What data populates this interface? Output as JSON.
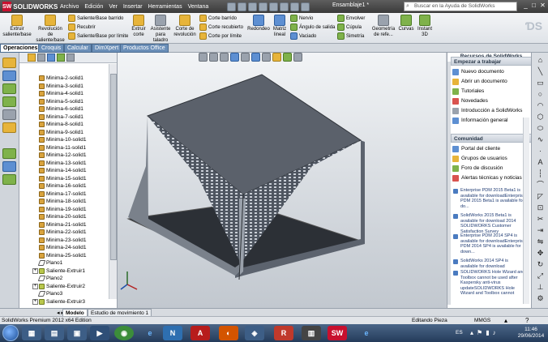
{
  "app": {
    "logo_text": "SOLIDWORKS",
    "logo_mark": "SW",
    "menu": [
      "Archivo",
      "Edición",
      "Ver",
      "Insertar",
      "Herramientas",
      "Ventana"
    ],
    "document_title": "Ensamblaje1 *",
    "search_placeholder": "Buscar en la Ayuda de SolidWorks",
    "window_controls": [
      "_",
      "□",
      "✕"
    ]
  },
  "ribbon": {
    "big": [
      {
        "label1": "Extruir",
        "label2": "saliente/base",
        "icon": "extrude-boss-icon",
        "color": "y"
      },
      {
        "label1": "Revolución",
        "label2": "de saliente/base",
        "icon": "revolve-boss-icon",
        "color": "y"
      },
      {
        "label1": "Extruir",
        "label2": "corte",
        "icon": "extrude-cut-icon",
        "color": "y"
      },
      {
        "label1": "Asistente",
        "label2": "para taladro",
        "icon": "hole-wizard-icon",
        "color": "gr"
      },
      {
        "label1": "Corte de",
        "label2": "revolución",
        "icon": "revolve-cut-icon",
        "color": "y"
      },
      {
        "label1": "Redondeo",
        "label2": "",
        "icon": "fillet-icon",
        "color": "b"
      },
      {
        "label1": "Matriz",
        "label2": "lineal",
        "icon": "linear-pattern-icon",
        "color": "b"
      },
      {
        "label1": "Geometría",
        "label2": "de refe...",
        "icon": "reference-geometry-icon",
        "color": "gr"
      },
      {
        "label1": "Curvas",
        "label2": "",
        "icon": "curves-icon",
        "color": "g"
      },
      {
        "label1": "Instant",
        "label2": "3D",
        "icon": "instant3d-icon",
        "color": "g"
      }
    ],
    "small": [
      {
        "label": "Saliente/Base barrido",
        "icon": "swept-boss-icon",
        "color": "y"
      },
      {
        "label": "Recubrir",
        "icon": "loft-icon",
        "color": "y"
      },
      {
        "label": "Saliente/Base por límite",
        "icon": "boundary-boss-icon",
        "color": "y"
      },
      {
        "label": "Corte barrido",
        "icon": "swept-cut-icon",
        "color": "y"
      },
      {
        "label": "Corte recubierto",
        "icon": "lofted-cut-icon",
        "color": "y"
      },
      {
        "label": "Corte por límite",
        "icon": "boundary-cut-icon",
        "color": "y"
      },
      {
        "label": "Nervio",
        "icon": "rib-icon",
        "color": "g"
      },
      {
        "label": "Ángulo de salida",
        "icon": "draft-icon",
        "color": "g"
      },
      {
        "label": "Vaciado",
        "icon": "shell-icon",
        "color": "b"
      },
      {
        "label": "Envolver",
        "icon": "wrap-icon",
        "color": "g"
      },
      {
        "label": "Cúpula",
        "icon": "dome-icon",
        "color": "g"
      },
      {
        "label": "Simetría",
        "icon": "mirror-icon",
        "color": "g"
      }
    ]
  },
  "tabs": [
    "Operaciones",
    "Croquis",
    "Calcular",
    "DimXpert",
    "Productos Office"
  ],
  "tree": {
    "items": [
      {
        "label": "Minima-2-solid1",
        "type": "part"
      },
      {
        "label": "Minima-3-solid1",
        "type": "part"
      },
      {
        "label": "Minima-4-solid1",
        "type": "part"
      },
      {
        "label": "Minima-5-solid1",
        "type": "part"
      },
      {
        "label": "Minima-6-solid1",
        "type": "part"
      },
      {
        "label": "Minima-7-solid1",
        "type": "part"
      },
      {
        "label": "Minima-8-solid1",
        "type": "part"
      },
      {
        "label": "Minima-9-solid1",
        "type": "part"
      },
      {
        "label": "Minima-10-solid1",
        "type": "part"
      },
      {
        "label": "Minima-11-solid1",
        "type": "part"
      },
      {
        "label": "Minima-12-solid1",
        "type": "part"
      },
      {
        "label": "Minima-13-solid1",
        "type": "part"
      },
      {
        "label": "Minima-14-solid1",
        "type": "part"
      },
      {
        "label": "Minima-15-solid1",
        "type": "part"
      },
      {
        "label": "Minima-16-solid1",
        "type": "part"
      },
      {
        "label": "Minima-17-solid1",
        "type": "part"
      },
      {
        "label": "Minima-18-solid1",
        "type": "part"
      },
      {
        "label": "Minima-19-solid1",
        "type": "part"
      },
      {
        "label": "Minima-20-solid1",
        "type": "part"
      },
      {
        "label": "Minima-21-solid1",
        "type": "part"
      },
      {
        "label": "Minima-22-solid1",
        "type": "part"
      },
      {
        "label": "Minima-23-solid1",
        "type": "part"
      },
      {
        "label": "Minima-24-solid1",
        "type": "part"
      },
      {
        "label": "Minima-25-solid1",
        "type": "part"
      },
      {
        "label": "Plano1",
        "type": "plane"
      },
      {
        "label": "Saliente-Extruir1",
        "type": "feat"
      },
      {
        "label": "Plano2",
        "type": "plane"
      },
      {
        "label": "Saliente-Extruir2",
        "type": "feat"
      },
      {
        "label": "Plano3",
        "type": "plane"
      },
      {
        "label": "Saliente-Extruir3",
        "type": "feat"
      }
    ]
  },
  "taskpane": {
    "title": "Recursos de SolidWorks",
    "sections": [
      {
        "header": "Empezar a trabajar",
        "items": [
          {
            "label": "Nuevo documento",
            "icon": "new-document-icon"
          },
          {
            "label": "Abrir un documento",
            "icon": "open-document-icon"
          },
          {
            "label": "Tutoriales",
            "icon": "tutorials-icon"
          },
          {
            "label": "Novedades",
            "icon": "whats-new-icon"
          },
          {
            "label": "Introducción a SolidWorks",
            "icon": "intro-icon"
          },
          {
            "label": "Información general",
            "icon": "info-icon"
          }
        ]
      },
      {
        "header": "Comunidad",
        "items": [
          {
            "label": "Portal del cliente",
            "icon": "portal-icon"
          },
          {
            "label": "Grupos de usuarios",
            "icon": "user-groups-icon"
          },
          {
            "label": "Foro de discusión",
            "icon": "forum-icon"
          },
          {
            "label": "Alertas técnicas y noticias",
            "icon": "rss-icon"
          }
        ]
      }
    ],
    "news": [
      "Enterprise PDM 2015 Beta1 is available for downloadEnterprise PDM 2015 Beta1 is available for do...",
      "SolidWorks 2015 Beta1 is available for download 2014 SOLIDWORKS Customer Satisfaction Survey",
      "Enterprise PDM 2014 SP4 is available for downloadEnterprise PDM 2014 SP4 is available for down...",
      "SolidWorks 2014 SP4 is available for download",
      "SOLIDWORKS Hole Wizard and Toolbox cannot be used after Kaspersky anti-virus updateSOLIDWORKS Hole Wizard and Toolbox cannot"
    ]
  },
  "bottom_tabs": [
    "Modelo",
    "Estudio de movimiento 1"
  ],
  "status": {
    "left": "SolidWorks Premium 2012 x64 Edition",
    "mode": "Editando Pieza",
    "units": "MMGS"
  },
  "taskbar": {
    "language": "ES",
    "time": "11:46",
    "date": "29/06/2014"
  }
}
